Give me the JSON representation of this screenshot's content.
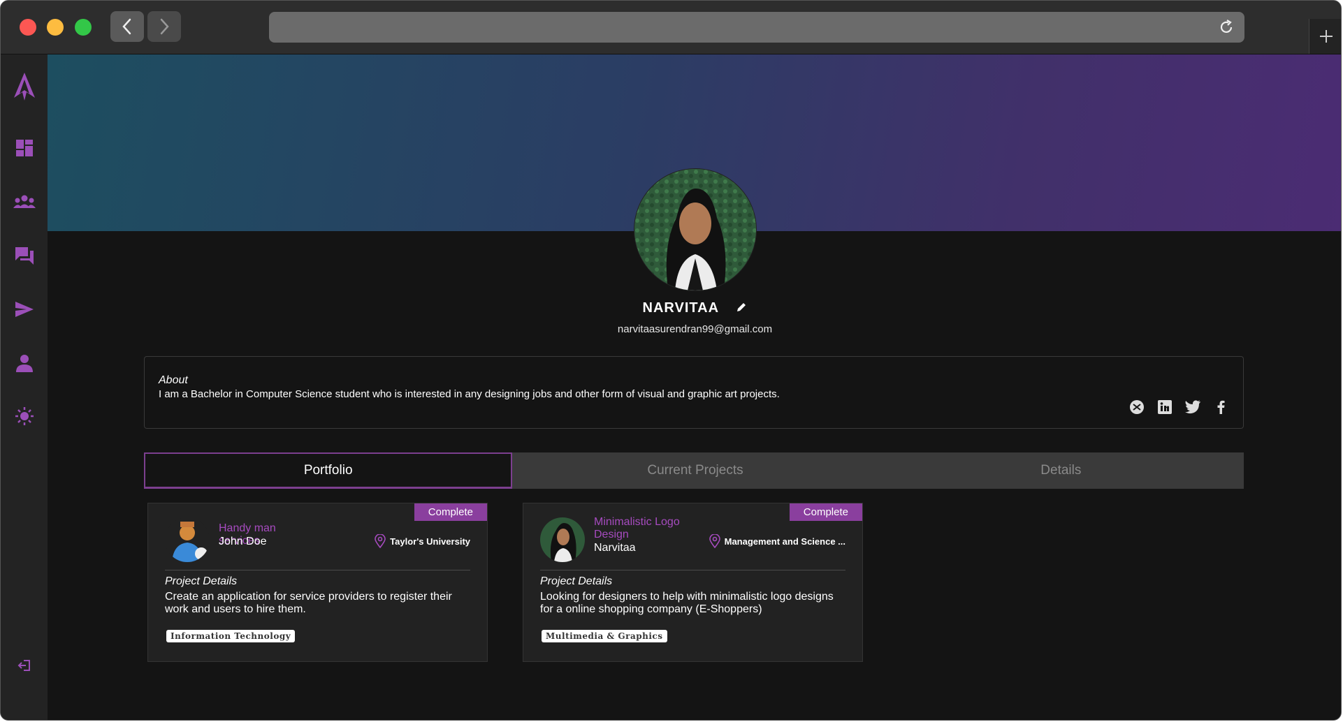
{
  "browser": {
    "url": ""
  },
  "sidebar": {
    "items": [
      {
        "icon": "logo-icon"
      },
      {
        "icon": "dashboard-icon"
      },
      {
        "icon": "groups-icon"
      },
      {
        "icon": "chat-icon"
      },
      {
        "icon": "send-icon"
      },
      {
        "icon": "person-icon"
      },
      {
        "icon": "sun-icon"
      },
      {
        "icon": "logout-icon"
      }
    ],
    "accent": "#8e44ad"
  },
  "profile": {
    "name": "NARVITAA",
    "email": "narvitaasurendran99@gmail.com"
  },
  "about": {
    "title": "About",
    "text": "I am a Bachelor in Computer Science student who is interested in any designing jobs and other form of visual and graphic art projects.",
    "socials": [
      "mail-icon",
      "linkedin-icon",
      "twitter-icon",
      "facebook-icon"
    ]
  },
  "tabs": [
    {
      "label": "Portfolio",
      "active": true
    },
    {
      "label": "Current Projects",
      "active": false
    },
    {
      "label": "Details",
      "active": false
    }
  ],
  "cards": [
    {
      "status": "Complete",
      "title": "Handy man services",
      "owner": "John Doe",
      "location": "Taylor's University",
      "details_label": "Project Details",
      "details": "Create an application for service providers to register their work and users to hire them.",
      "tag": "Information Technology"
    },
    {
      "status": "Complete",
      "title": "Minimalistic Logo Design",
      "owner": "Narvitaa",
      "location": "Management and Science ...",
      "details_label": "Project Details",
      "details": "Looking for designers to help with minimalistic logo designs for a online shopping company (E-Shoppers)",
      "tag": "Multimedia & Graphics"
    }
  ],
  "colors": {
    "accent": "#8a3f9e",
    "background": "#141414",
    "banner_start": "#1d4e60",
    "banner_end": "#4b2c73"
  }
}
